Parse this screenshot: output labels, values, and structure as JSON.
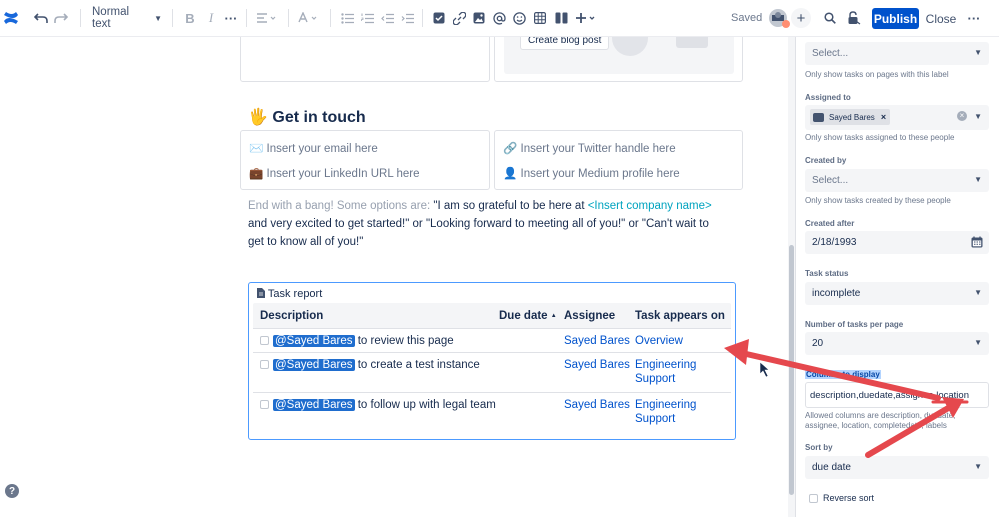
{
  "toolbar": {
    "text_style": "Normal text",
    "saved": "Saved",
    "publish": "Publish",
    "close": "Close"
  },
  "editor": {
    "create_blog_button": "Create blog post",
    "heading": "Get in touch",
    "heading_emoji": "🖐",
    "contacts": {
      "email": "Insert your email here",
      "linkedin": "Insert your LinkedIn URL here",
      "twitter": "Insert your Twitter handle here",
      "medium": "Insert your Medium profile here"
    },
    "closing": {
      "intro": "End with a bang! Some options are: ",
      "quote1": "\"I am so grateful to be here at ",
      "company": "<Insert company name>",
      "rest": " and very excited to get started!\" or \"Looking forward to meeting all of you!\" or \"Can't wait to get to know all of you!\""
    },
    "task_report": {
      "title": "Task report",
      "columns": {
        "description": "Description",
        "due_date": "Due date",
        "due_sort_icon": "▲",
        "assignee": "Assignee",
        "appears_on": "Task appears on"
      },
      "rows": [
        {
          "mention": "@Sayed Bares",
          "text": " to review this page",
          "assignee": "Sayed Bares",
          "page1": "Overview",
          "page2": ""
        },
        {
          "mention": "@Sayed Bares",
          "text": " to create a test instance",
          "assignee": "Sayed Bares",
          "page1": "Engineering",
          "page2": "Support"
        },
        {
          "mention": "@Sayed Bares",
          "text": " to follow up with legal team",
          "assignee": "Sayed Bares",
          "page1": "Engineering",
          "page2": "Support"
        }
      ]
    }
  },
  "sidebar": {
    "label_select": {
      "value": "Select...",
      "hint": "Only show tasks on pages with this label"
    },
    "assigned_to": {
      "label": "Assigned to",
      "chip": "Sayed Bares",
      "hint": "Only show tasks assigned to these people"
    },
    "created_by": {
      "label": "Created by",
      "value": "Select...",
      "hint": "Only show tasks created by these people"
    },
    "created_after": {
      "label": "Created after",
      "value": "2/18/1993"
    },
    "task_status": {
      "label": "Task status",
      "value": "incomplete"
    },
    "tasks_per_page": {
      "label": "Number of tasks per page",
      "value": "20"
    },
    "columns": {
      "label": "Columns to display",
      "value": "description,duedate,assignee,location",
      "hint_line1": "Allowed columns are description, duedate,",
      "hint_line2": "assignee, location, completedate, labels"
    },
    "sort_by": {
      "label": "Sort by",
      "value": "due date"
    },
    "reverse_sort": "Reverse sort"
  },
  "help": "?",
  "colors": {
    "accent": "#0052cc",
    "annotation": "#e5484d",
    "mention_bg": "#1f6dce",
    "link": "#00a3bf"
  }
}
